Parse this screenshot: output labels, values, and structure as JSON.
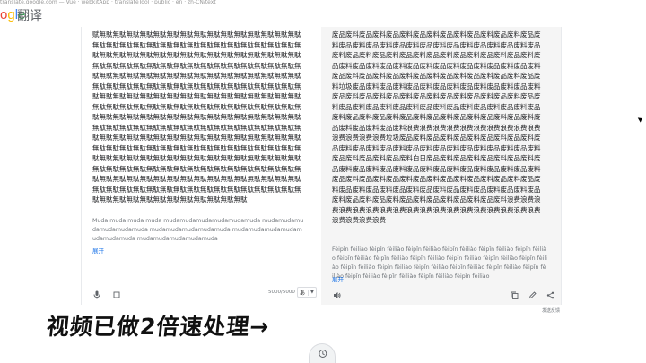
{
  "browser": {
    "url": "translate.google.com  — Vue · webkitApp · translateTool · public · en · zh-CN/text"
  },
  "header": {
    "logo_text": "ogle",
    "product_name": "翻译"
  },
  "source": {
    "text": "赋無駄無駄無駄無駄無駄無駄無駄無駄無駄無駄無駄無駄無駄無駄無駄無駄無駄無駄無駄無駄無駄無駄無駄無駄無駄無駄無駄無駄無駄無駄無駄無駄無駄無駄無駄無駄無駄無駄無駄無駄無駄無駄無駄無駄無駄無駄無駄無駄無駄無駄無駄無駄無駄無駄無駄無駄無駄無駄無駄無駄無駄無駄無駄無駄無駄無駄無駄無駄無駄無駄無駄無駄無駄無駄無駄無駄無駄無駄無駄無駄無駄無駄無駄無駄無駄無駄無駄無駄無駄無駄無駄無駄無駄無駄無駄無駄無駄無駄無駄無駄無駄無駄無駄無駄無駄無駄無駄無駄無駄無駄無駄無駄無駄無駄無駄無駄無駄無駄無駄無駄無駄無駄無駄無駄無駄無駄無駄無駄無駄無駄無駄無駄無駄無駄無駄無駄無駄無駄無駄無駄無駄無駄無駄無駄無駄無駄無駄無駄無駄無駄無駄無駄無駄無駄無駄無駄無駄無駄無駄無駄無駄無駄無駄無駄無駄無駄無駄無駄無駄無駄無駄無駄無駄無駄無駄無駄無駄無駄無駄無駄無駄無駄無駄無駄無駄無駄無駄無駄無駄無駄無駄無駄無駄無駄無駄無駄無駄無駄無駄無駄無駄無駄無駄無駄無駄無駄無駄無駄無駄無駄無駄無駄無駄無駄無駄無駄無駄無駄無駄無駄無駄無駄無駄無駄無駄無駄無駄無駄無駄無駄無駄無駄無駄無駄無駄無駄無駄無駄無駄無駄無駄無駄無駄無駄無駄無駄無駄無駄無駄無駄無駄無駄無駄無駄無駄無駄無駄無駄無駄",
    "transliteration": "Muda muda muda muda mudamudamudamudamudamuda mudamudamudamudamudamuda mudamudamudamudamuda mudamudamudamudamudamudamuda mudamudamudamudamuda",
    "expand_label": "展开",
    "char_count": "5000/5000",
    "ime_label": "あ"
  },
  "target": {
    "text": "废品废料废品废料废品废料废品废料废品废料废品废料废品废料废品废料废品废料废品废料废品废料废品废料废品废料废品废料废品废料废品废料废品废料废品废料废品废料废品废料废品废料废品废料废品废料废品废料废品废料废品废料废品废料废品废料废品废料废品废料废品废料废品废料废品废料废品废料废品废料废品废料废品废料废品废料废品废料垃圾废品废料废品废料废品废料废品废料废品废料废品废料废品废料废品废料废品废料废品废料废品废料废品废料废品废料废品废料废品废料废品废料废品废料废品废料废品废料废品废料废品废料废品废料废品废料废品废料废品废料废品废料废品废料废品废料废品废料废品废料废品废料废品废料废品废料浪费浪费浪费浪费浪费浪费浪费浪费浪费浪费浪费浪费浪费浪费垃圾废品废料废品废料废品废料废品废料废品废料废品废料废品废料废品废料废品废料废品废料废品废料废品废料废品废料废品废料废品废料废品废料白日废品废料废品废料废品废料废品废料废品废料废品废料废品废料废品废料废品废料废品废料废品废料废品废料废品废料废品废料废品废料废品废料废品废料废品废料废品废料废品废料废品废料废品废料废品废料废品废料废品废料废品废料废品废料废品废料废品废料废品废料废品废料废品废料废品废料废品废料浪费浪费浪费浪费浪费浪费浪费浪费浪费浪费浪费浪费浪费浪费浪费浪费浪费浪费浪费浪费浪费浪费",
    "transliteration": "Fèipǐn fèiliào fèipǐn fèiliào fèipǐn fèiliào fèipǐn fèiliào fèipǐn fèiliào fèipǐn fèiliào fèipǐn fèiliào fèipǐn fèiliào fèipǐn fèiliào fèipǐn fèiliào fèipǐn fèiliào fèipǐn fèiliào fèipǐn fèiliào fèipǐn fèiliào fèipǐn fèiliào fèipǐn fèiliào fèipǐn fèiliào fèipǐn fèiliào fèipǐn fèiliào fèipǐn fèiliào fèipǐn fèiliào fèipǐn fèiliào",
    "expand_label": "展开"
  },
  "footer": {
    "feedback_label": "发送反馈"
  },
  "overlay": {
    "caption": "视频已做2倍速处理→"
  },
  "icons": {
    "mic": "microphone-icon",
    "keyboard": "keyboard-icon",
    "speaker": "speaker-icon",
    "copy": "copy-icon",
    "edit": "pencil-icon",
    "share": "share-icon",
    "history": "history-icon"
  }
}
